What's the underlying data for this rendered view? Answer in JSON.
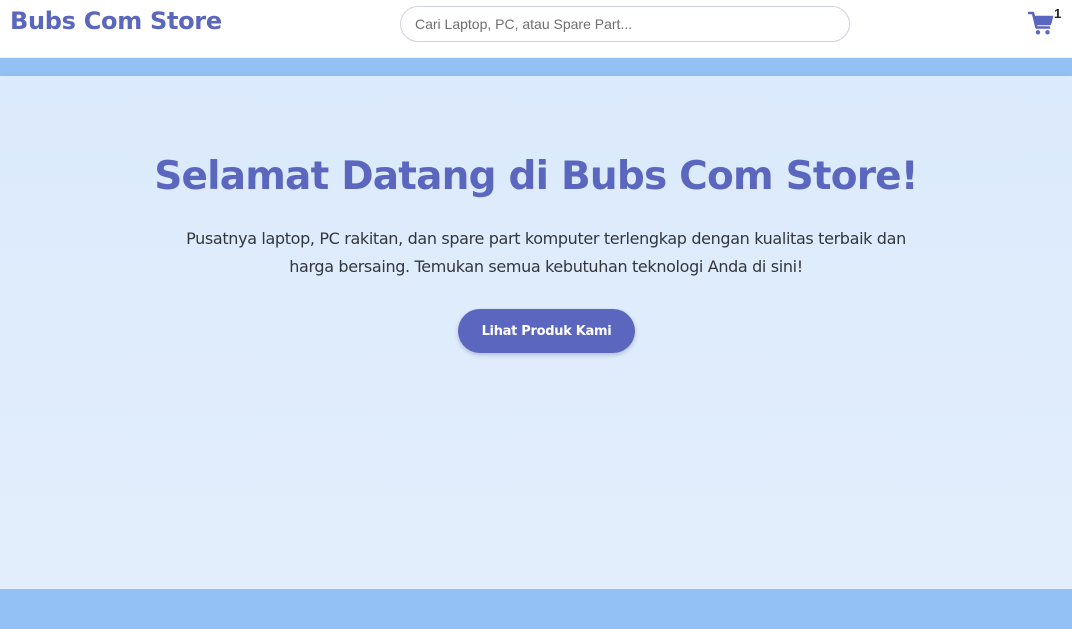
{
  "header": {
    "brand": "Bubs Com Store",
    "search": {
      "placeholder": "Cari Laptop, PC, atau Spare Part...",
      "value": ""
    },
    "cart": {
      "icon": "shopping-cart-icon",
      "count": "1"
    }
  },
  "hero": {
    "title": "Selamat Datang di Bubs Com Store!",
    "description": "Pusatnya laptop, PC rakitan, dan spare part komputer terlengkap dengan kualitas terbaik dan harga bersaing. Temukan semua kebutuhan teknologi Anda di sini!",
    "cta_label": "Lihat Produk Kami"
  },
  "colors": {
    "brand": "#5b66be",
    "hero_background": "#dbeafc",
    "accent_band": "#93c0f5"
  }
}
